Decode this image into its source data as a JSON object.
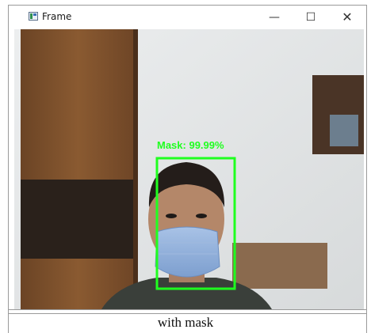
{
  "window": {
    "title": "Frame",
    "minimize_glyph": "—",
    "maximize_glyph": "☐",
    "close_glyph": "✕"
  },
  "detection": {
    "label": "Mask: 99.99%",
    "box_color": "#1fff1f"
  },
  "caption": "with mask"
}
